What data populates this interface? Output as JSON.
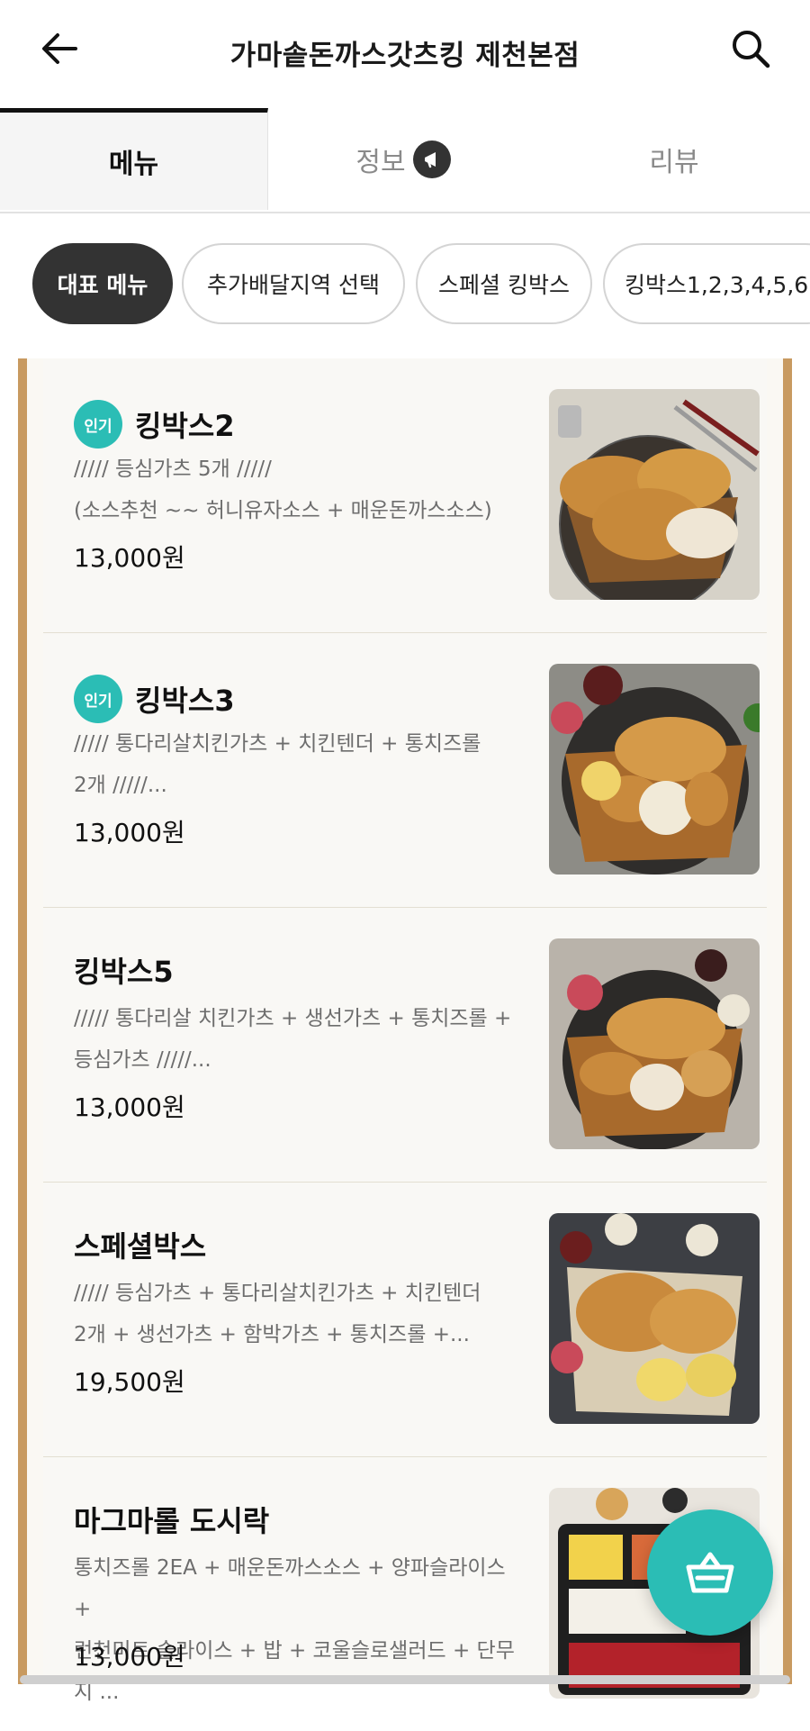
{
  "header": {
    "title": "가마솥돈까스갓츠킹 제천본점"
  },
  "tabs": [
    {
      "label": "메뉴"
    },
    {
      "label": "정보"
    },
    {
      "label": "리뷰"
    }
  ],
  "chips": [
    {
      "label": "대표 메뉴"
    },
    {
      "label": "추가배달지역 선택"
    },
    {
      "label": "스페셜 킹박스"
    },
    {
      "label": "킹박스1,2,3,4,5,6"
    }
  ],
  "items": [
    {
      "name": "킹박스2",
      "badge": "인기",
      "desc1": "///// 등심가츠 5개 /////",
      "desc2": "(소스추천 ~~ 허니유자소스 + 매운돈까스소스)",
      "price": "13,000원"
    },
    {
      "name": "킹박스3",
      "badge": "인기",
      "desc1": "///// 통다리살치킨가츠 + 치킨텐더 + 통치즈롤",
      "desc2": "2개 /////...",
      "price": "13,000원"
    },
    {
      "name": "킹박스5",
      "badge": "",
      "desc1": "///// 통다리살 치킨가츠 + 생선가츠 + 통치즈롤 +",
      "desc2": "등심가츠 /////...",
      "price": "13,000원"
    },
    {
      "name": "스페셜박스",
      "badge": "",
      "desc1": "/////  등심가츠 + 통다리살치킨가츠 + 치킨텐더",
      "desc2": "2개 + 생선가츠 + 함박가츠 + 통치즈롤 +...",
      "price": "19,500원"
    },
    {
      "name": "마그마롤 도시락",
      "badge": "",
      "desc1": "통치즈롤 2EA + 매운돈까스소스 + 양파슬라이스 +",
      "desc2": "런천미트 슬라이스 + 밥 + 코울슬로샐러드 + 단무지 ...",
      "price": "13,000원"
    }
  ],
  "icons": {
    "back": "arrow-left-icon",
    "search": "search-icon",
    "info": "megaphone-icon",
    "cart": "basket-icon"
  },
  "colors": {
    "accent": "#2bbdb5",
    "frame": "#c89a60",
    "chip_active": "#333333"
  }
}
